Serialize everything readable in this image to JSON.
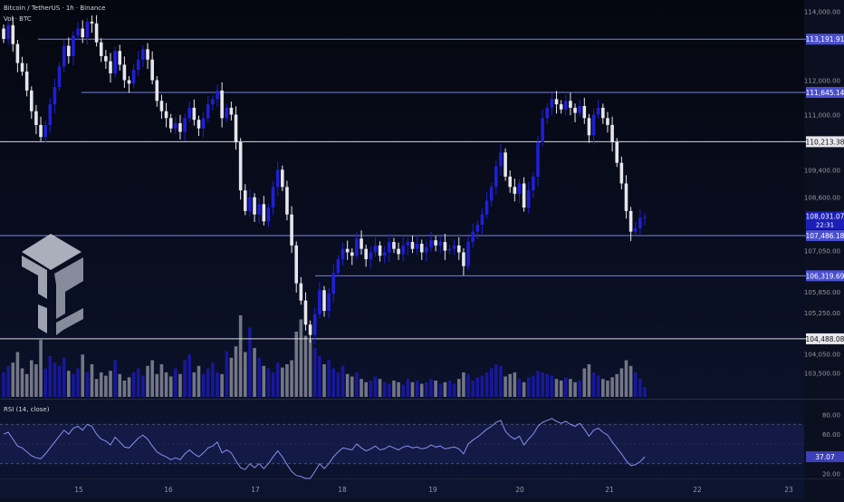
{
  "header": {
    "symbol_line": "Bitcoin / TetherUS · 1h · Binance",
    "volume_line": "Vol · BTC"
  },
  "rsi_panel": {
    "label": "RSI (14, close)",
    "current_value": "37.07"
  },
  "colors": {
    "background": "#0b1020",
    "up_candle": "#1f1fd6",
    "down_candle": "#e6e6ec",
    "level_line_blue": "#7b7fe0",
    "level_line_white": "#d9d9e0",
    "rsi_line": "#8a90ee",
    "rsi_band_fill": "#141c4a"
  },
  "chart_data": [
    {
      "type": "candlestick",
      "price_axis_labels": [
        "114,000.00",
        "112,000.00",
        "111,000.00",
        "109,400.00",
        "108,600.00",
        "107,050.00",
        "105,850.00",
        "105,250.00",
        "104,050.00",
        "103,500.00"
      ],
      "x_tick_labels": [
        "15",
        "16",
        "17",
        "18",
        "19",
        "20",
        "21",
        "22",
        "23"
      ],
      "levels": [
        {
          "label": "113,191.91",
          "value": 113191.91,
          "style": "blue"
        },
        {
          "label": "111,645.14",
          "value": 111645.14,
          "style": "blue"
        },
        {
          "label": "110,213.38",
          "value": 110213.38,
          "style": "white"
        },
        {
          "label": "107,486.18",
          "value": 107486.18,
          "style": "blue"
        },
        {
          "label": "106,319.69",
          "value": 106319.69,
          "style": "blue"
        },
        {
          "label": "104,488.08",
          "value": 104488.08,
          "style": "white"
        }
      ],
      "last_price": {
        "label": "108,031.07",
        "countdown": "22:31",
        "value": 108031.07
      },
      "candles_close": [
        113200,
        113600,
        113050,
        112500,
        112250,
        111700,
        111100,
        110700,
        110350,
        110700,
        111300,
        111800,
        112400,
        113000,
        112700,
        113300,
        113500,
        113250,
        113700,
        113650,
        113100,
        112700,
        112550,
        112200,
        112850,
        112450,
        112000,
        111900,
        112300,
        112600,
        112900,
        112600,
        112000,
        111400,
        111100,
        110900,
        110600,
        110750,
        110500,
        110900,
        111200,
        110850,
        110600,
        110900,
        111300,
        111450,
        111700,
        110900,
        111200,
        111000,
        110200,
        108800,
        108200,
        108600,
        108100,
        108400,
        107900,
        108300,
        108900,
        109400,
        108900,
        108100,
        107200,
        106100,
        105600,
        104900,
        104600,
        105200,
        105900,
        105300,
        105800,
        106400,
        106800,
        107100,
        107000,
        106900,
        107400,
        107100,
        106800,
        107000,
        107200,
        106900,
        107000,
        107300,
        107100,
        106950,
        107200,
        107300,
        107100,
        107250,
        107000,
        107150,
        107350,
        107200,
        107300,
        107050,
        107100,
        107200,
        107000,
        106600,
        107300,
        107600,
        107800,
        108100,
        108500,
        108900,
        109500,
        109900,
        109200,
        108900,
        108700,
        109000,
        108300,
        108800,
        109200,
        110200,
        110900,
        111200,
        111450,
        111300,
        111150,
        111400,
        111200,
        111050,
        111250,
        110900,
        110400,
        111000,
        111200,
        110900,
        110700,
        110200,
        109600,
        109000,
        108200,
        107600,
        107700,
        108000,
        108031
      ]
    },
    {
      "type": "line",
      "series_label": "RSI (14, close)",
      "y_axis_labels": [
        "80.00",
        "60.00",
        "37.07",
        "20.00"
      ],
      "ylim": [
        15,
        85
      ],
      "band_levels": [
        70,
        30
      ],
      "mid_level": 50,
      "values": [
        60,
        62,
        55,
        48,
        46,
        42,
        38,
        36,
        35,
        40,
        46,
        52,
        58,
        64,
        60,
        66,
        68,
        64,
        70,
        68,
        60,
        55,
        53,
        49,
        57,
        52,
        47,
        46,
        51,
        56,
        59,
        55,
        48,
        42,
        39,
        37,
        34,
        36,
        34,
        40,
        44,
        40,
        37,
        41,
        46,
        48,
        52,
        41,
        44,
        41,
        33,
        26,
        24,
        30,
        26,
        30,
        25,
        30,
        37,
        43,
        37,
        29,
        22,
        18,
        17,
        15,
        15,
        22,
        30,
        25,
        30,
        37,
        42,
        46,
        45,
        44,
        50,
        46,
        43,
        45,
        48,
        44,
        45,
        48,
        46,
        44,
        47,
        48,
        46,
        47,
        45,
        46,
        49,
        47,
        48,
        45,
        46,
        47,
        45,
        40,
        50,
        54,
        57,
        61,
        65,
        68,
        72,
        74,
        63,
        58,
        55,
        58,
        49,
        55,
        60,
        68,
        72,
        74,
        76,
        73,
        71,
        73,
        70,
        68,
        71,
        65,
        58,
        64,
        66,
        62,
        59,
        52,
        46,
        40,
        33,
        28,
        29,
        32,
        37
      ]
    },
    {
      "type": "bar",
      "series_label": "Vol · BTC",
      "values": [
        30,
        38,
        42,
        55,
        35,
        28,
        45,
        40,
        70,
        35,
        50,
        42,
        38,
        48,
        32,
        28,
        35,
        52,
        30,
        40,
        22,
        30,
        26,
        32,
        45,
        28,
        20,
        24,
        30,
        35,
        26,
        38,
        45,
        28,
        40,
        30,
        25,
        35,
        28,
        45,
        52,
        30,
        38,
        28,
        35,
        42,
        30,
        28,
        56,
        48,
        62,
        100,
        55,
        85,
        60,
        48,
        38,
        35,
        30,
        42,
        36,
        40,
        45,
        80,
        95,
        75,
        70,
        60,
        50,
        40,
        45,
        35,
        30,
        38,
        28,
        25,
        30,
        22,
        18,
        20,
        25,
        22,
        18,
        16,
        20,
        18,
        15,
        22,
        18,
        20,
        16,
        18,
        22,
        20,
        16,
        18,
        20,
        16,
        22,
        30,
        28,
        20,
        24,
        26,
        30,
        35,
        40,
        38,
        25,
        28,
        30,
        22,
        18,
        24,
        26,
        32,
        30,
        28,
        26,
        22,
        20,
        24,
        22,
        18,
        20,
        35,
        40,
        30,
        26,
        22,
        20,
        24,
        28,
        35,
        45,
        38,
        30,
        22,
        12
      ]
    }
  ]
}
